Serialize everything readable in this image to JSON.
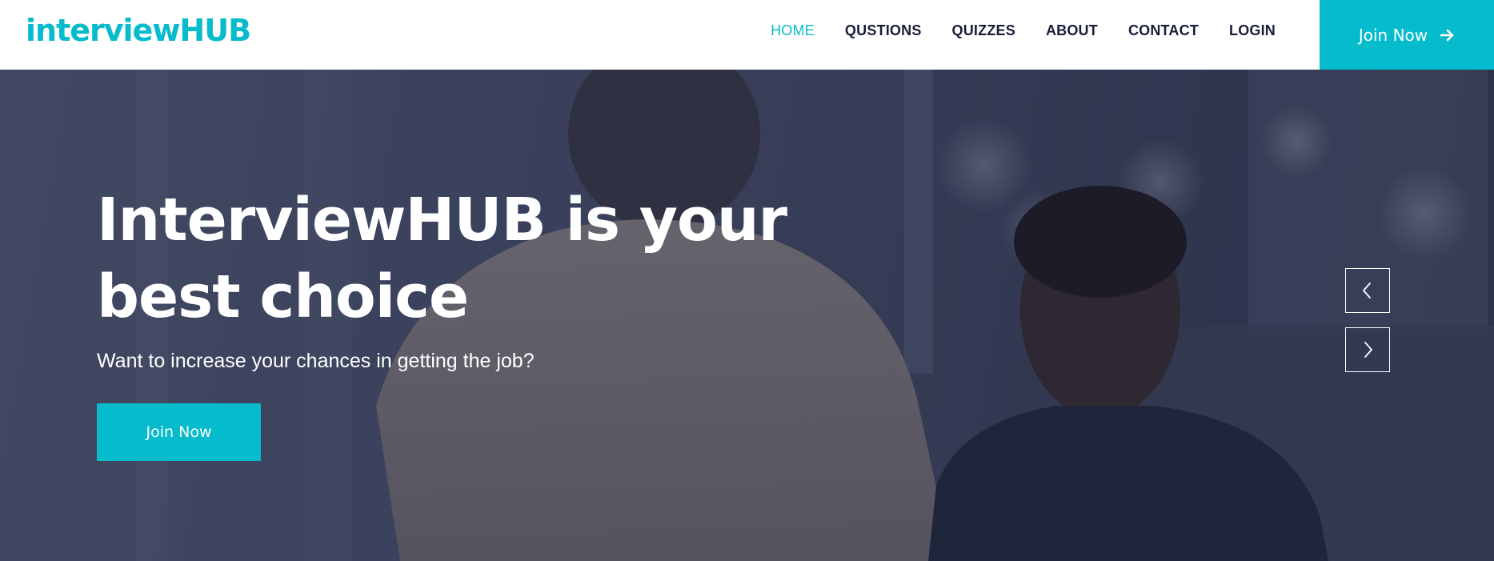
{
  "navbar": {
    "brand": "interviewHUB",
    "links": [
      {
        "label": "HOME",
        "active": true
      },
      {
        "label": "QUSTIONS",
        "active": false
      },
      {
        "label": "QUIZZES",
        "active": false
      },
      {
        "label": "ABOUT",
        "active": false
      },
      {
        "label": "CONTACT",
        "active": false
      },
      {
        "label": "LOGIN",
        "active": false
      }
    ],
    "cta_label": "Join Now",
    "cta_icon": "arrow-right-icon"
  },
  "hero": {
    "title": "InterviewHUB is your best choice",
    "subtitle": "Want to increase your chances in getting the job?",
    "button_label": "Join Now",
    "carousel": {
      "prev_icon": "chevron-left-icon",
      "next_icon": "chevron-right-icon"
    }
  },
  "colors": {
    "accent": "#06bbcc",
    "nav_text": "#181d38",
    "hero_overlay": "#181d38",
    "white": "#ffffff"
  }
}
